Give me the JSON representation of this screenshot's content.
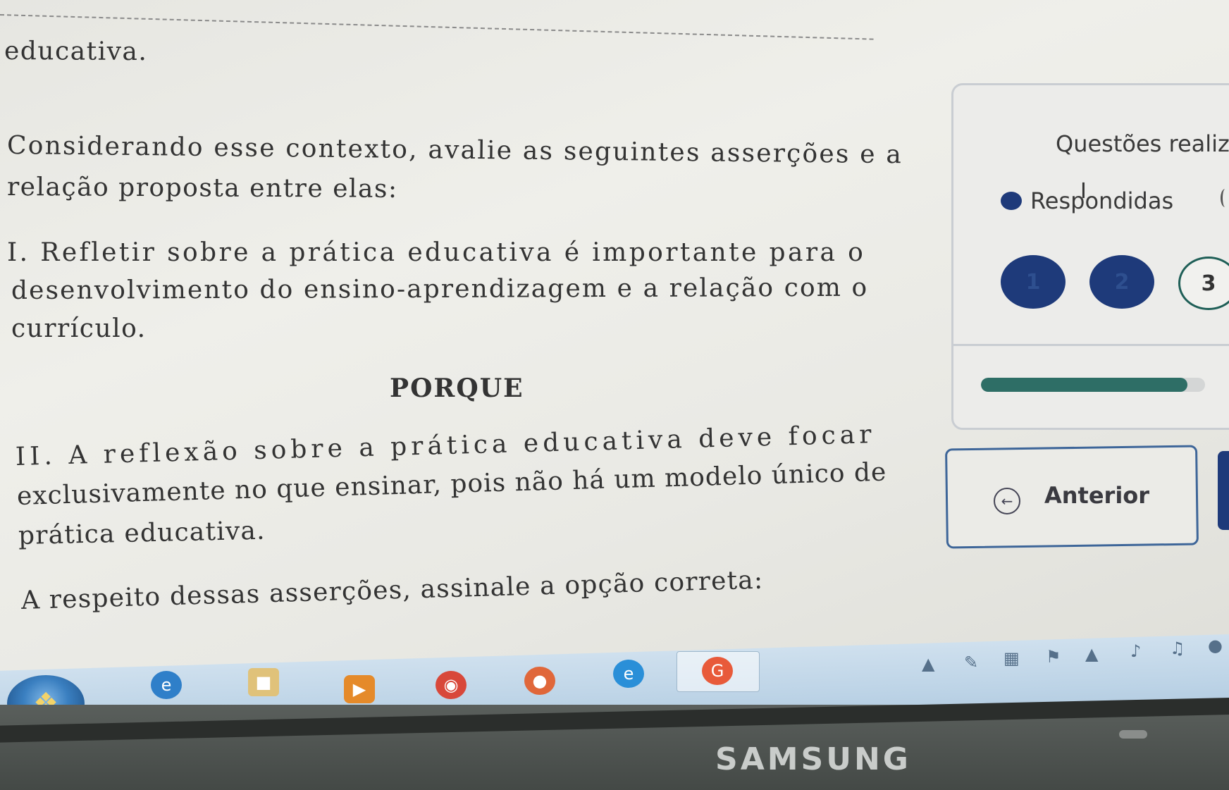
{
  "question": {
    "prev_tail": "educativa.",
    "context_prompt_1": "Considerando esse contexto, avalie as seguintes asserções e a",
    "context_prompt_2": "relação proposta entre elas:",
    "assertion1_1": "I. Refletir sobre a prática educativa é importante para o",
    "assertion1_2": "desenvolvimento do ensino-aprendizagem e a relação com o",
    "assertion1_3": "currículo.",
    "connector": "PORQUE",
    "assertion2_1": "II. A reflexão sobre a prática educativa deve focar",
    "assertion2_2": "exclusivamente no que ensinar, pois não há um modelo único de",
    "assertion2_3": "prática educativa.",
    "instruction": "A respeito dessas asserções, assinale a opção correta:"
  },
  "panel": {
    "title": "Questões realiz",
    "legend_label": "Respondidas",
    "cursor_glyph": "I",
    "legend_color": "#1e3a7a",
    "questions": [
      {
        "number": "1",
        "status": "answered"
      },
      {
        "number": "2",
        "status": "answered"
      },
      {
        "number": "3",
        "status": "unanswered"
      }
    ],
    "progress_fraction": 0.92,
    "progress_color": "#2e6e66"
  },
  "nav": {
    "prev_label": "Anterior",
    "prev_icon": "arrow-left-circle-icon"
  },
  "taskbar": {
    "icons": [
      "windows-start-icon",
      "internet-explorer-icon",
      "file-explorer-icon",
      "media-player-icon",
      "chrome-icon",
      "firefox-icon",
      "edge-icon",
      "google-icon"
    ],
    "tray_icons": [
      "network-icon",
      "pen-icon",
      "app-icon",
      "flag-icon",
      "wifi-icon",
      "volume-icon",
      "notification-icon"
    ]
  },
  "monitor": {
    "brand": "SAMSUNG"
  }
}
